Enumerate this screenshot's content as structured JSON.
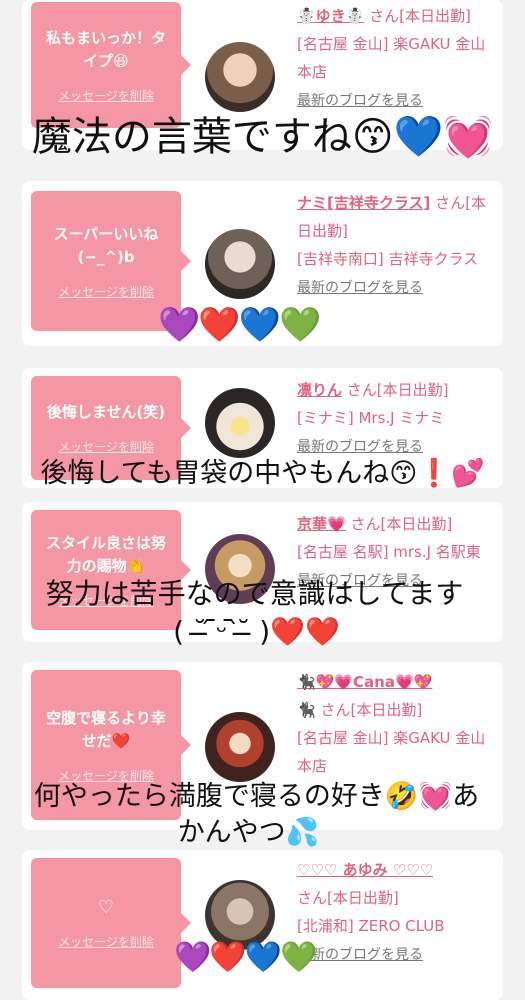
{
  "cards": [
    {
      "message": "私もまいっか！タイプ😆",
      "delete_label": "メッセージを削除",
      "name": "☃️ゆき☃️",
      "san": "さん[本日出勤]",
      "shop": "[名古屋 金山] 楽GAKU 金山本店",
      "blog": "最新のブログを見る"
    },
    {
      "message": "スーパーいいね (−_^)b",
      "delete_label": "メッセージを削除",
      "name": "ナミ[吉祥寺クラス]",
      "san": "さん[本日出勤]",
      "shop": "[吉祥寺南口] 吉祥寺クラス",
      "blog": "最新のブログを見る"
    },
    {
      "message": "後悔しません(笑)",
      "delete_label": "メッセージを削除",
      "name": "凛りん",
      "san": "さん[本日出勤]",
      "shop": "[ミナミ] Mrs.J ミナミ",
      "blog": "最新のブログを見る"
    },
    {
      "message": "スタイル良さは努力の賜物👏",
      "delete_label": "メッセージを削除",
      "name": "京華💗",
      "san": "さん[本日出勤]",
      "shop": "[名古屋 名駅] mrs.J 名駅東",
      "blog": "最新のブログを見る"
    },
    {
      "message": "空腹で寝るより幸せだ❤️",
      "delete_label": "メッセージを削除",
      "name": "🐈‍⬛💖💗Cana💗💖",
      "name2": "🐈‍⬛",
      "san": "さん[本日出勤]",
      "shop": "[名古屋 金山] 楽GAKU 金山本店",
      "blog": ""
    },
    {
      "message": "♡",
      "delete_label": "メッセージを削除",
      "name": "♡♡♡ あゆみ ♡♡♡",
      "san": "さん[本日出勤]",
      "shop": "[北浦和] ZERO CLUB",
      "blog": "最新のブログを見る"
    }
  ],
  "captions": {
    "c1": "魔法の言葉ですね😙💙💓",
    "c3": "後悔しても胃袋の中やもんね😙❗️💕",
    "c4a": "努力は苦手なので意識はしてます",
    "c4b": "( ˘̶ ᷇ᵕ ᷆˘̶ )❤️❤️",
    "c5a": "何やったら満腹で寝るの好き🤣💓あ",
    "c5b": "かんやつ💦"
  },
  "hearts": {
    "h2": "💜❤️💙💚",
    "h6": "💜❤️💙💚"
  },
  "colors": {
    "pink_bubble": "#f596a5",
    "pink_text": "#e0637f"
  }
}
